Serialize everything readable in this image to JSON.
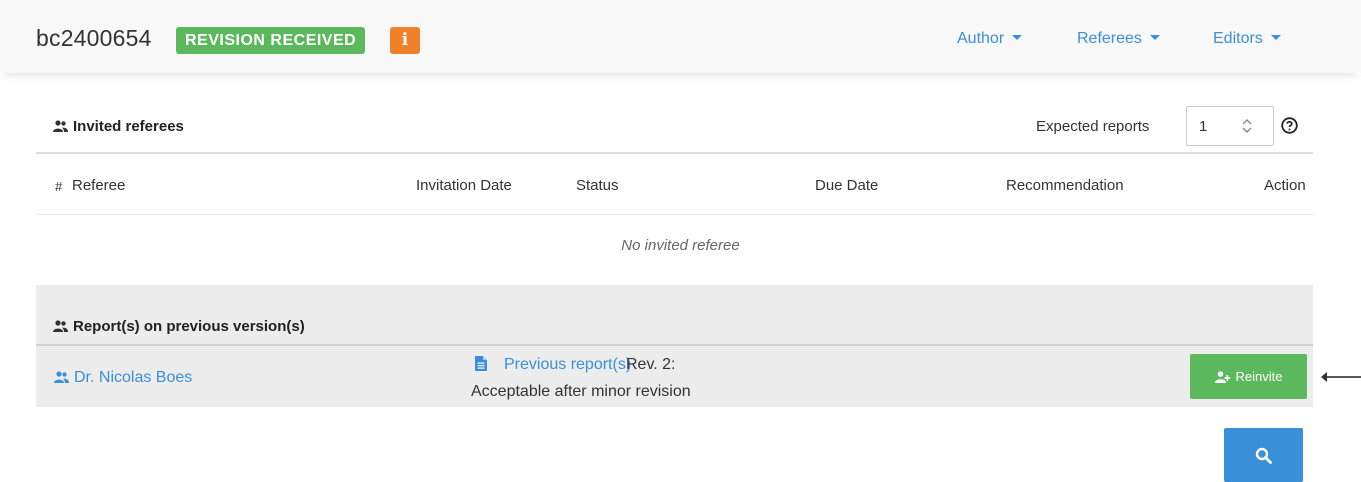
{
  "header": {
    "manuscript_id": "bc2400654",
    "status_badge": "REVISION RECEIVED",
    "info_badge": "i",
    "nav": [
      {
        "label": "Author"
      },
      {
        "label": "Referees"
      },
      {
        "label": "Editors"
      }
    ]
  },
  "invited": {
    "title": "Invited referees",
    "expected_label": "Expected reports",
    "expected_value": "1",
    "columns": {
      "hash": "#",
      "referee": "Referee",
      "invitation_date": "Invitation Date",
      "status": "Status",
      "due_date": "Due Date",
      "recommendation": "Recommendation",
      "action": "Action"
    },
    "empty_message": "No invited referee"
  },
  "previous": {
    "title": "Report(s) on previous version(s)",
    "rows": [
      {
        "referee": "Dr. Nicolas Boes",
        "link_label": "Previous report(s)",
        "revision": "Rev. 2:",
        "recommendation": "Acceptable after minor revision",
        "action_label": "Reinvite"
      }
    ]
  },
  "icons": {
    "people": "people-icon",
    "document": "document-icon",
    "help": "question-circle-icon",
    "user_plus": "user-plus-icon",
    "search": "search-icon",
    "arrow": "arrow-left-icon"
  },
  "colors": {
    "link": "#3a8fd9",
    "success": "#5cb85c",
    "warning": "#f0812b",
    "panel": "#ececec"
  }
}
